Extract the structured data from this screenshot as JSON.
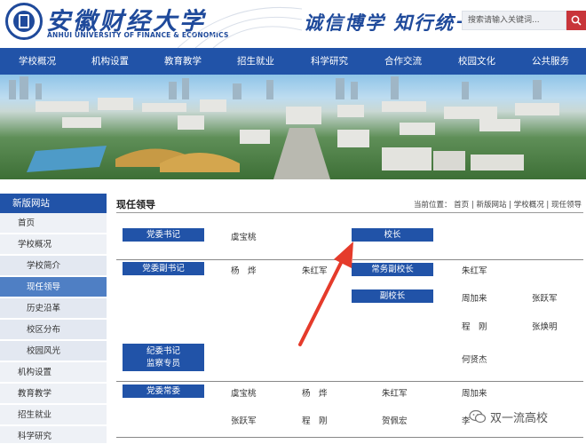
{
  "header": {
    "logo_cn": "安徽财经大学",
    "logo_en": "ANHUI UNIVERSITY OF FINANCE & ECONOMICS",
    "slogan": "诚信博学 知行统一",
    "search_placeholder": "搜索请输入关键词..."
  },
  "nav": [
    "学校概况",
    "机构设置",
    "教育教学",
    "招生就业",
    "科学研究",
    "合作交流",
    "校园文化",
    "公共服务"
  ],
  "sidebar": {
    "title": "新版网站",
    "items": [
      {
        "label": "首页",
        "type": "top"
      },
      {
        "label": "学校概况",
        "type": "top"
      },
      {
        "label": "学校简介",
        "type": "sub"
      },
      {
        "label": "现任领导",
        "type": "sub",
        "active": true
      },
      {
        "label": "历史沿革",
        "type": "sub"
      },
      {
        "label": "校区分布",
        "type": "sub"
      },
      {
        "label": "校园风光",
        "type": "sub"
      },
      {
        "label": "机构设置",
        "type": "top"
      },
      {
        "label": "教育教学",
        "type": "top"
      },
      {
        "label": "招生就业",
        "type": "top"
      },
      {
        "label": "科学研究",
        "type": "top"
      }
    ]
  },
  "content": {
    "title": "现任领导",
    "breadcrumb": "当前位置： 首页 | 新版网站 | 学校概况 | 现任领导"
  },
  "leaders": {
    "party_secretary": {
      "label": "党委书记",
      "names": [
        "虞宝桃"
      ]
    },
    "president": {
      "label": "校长",
      "names": []
    },
    "deputy_party_secretary": {
      "label": "党委副书记",
      "names": [
        "杨　烨",
        "朱红军"
      ]
    },
    "executive_vice_president": {
      "label": "常务副校长",
      "names": [
        "朱红军"
      ]
    },
    "vice_president": {
      "label": "副校长",
      "names": [
        "周加来",
        "张跃军",
        "程　刚",
        "张焕明"
      ]
    },
    "discipline_secretary": {
      "label_line1": "纪委书记",
      "label_line2": "监察专员",
      "names": [
        "何贤杰"
      ]
    },
    "standing_committee": {
      "label": "党委常委",
      "names": [
        "虞宝桃",
        "杨　烨",
        "朱红军",
        "周加来",
        "张跃军",
        "程　刚",
        "贺佩宏",
        "李"
      ]
    }
  },
  "watermark": "双一流高校",
  "colors": {
    "nav_blue": "#2153a8",
    "search_red": "#c8353a",
    "annotation_red": "#e53b2b"
  }
}
